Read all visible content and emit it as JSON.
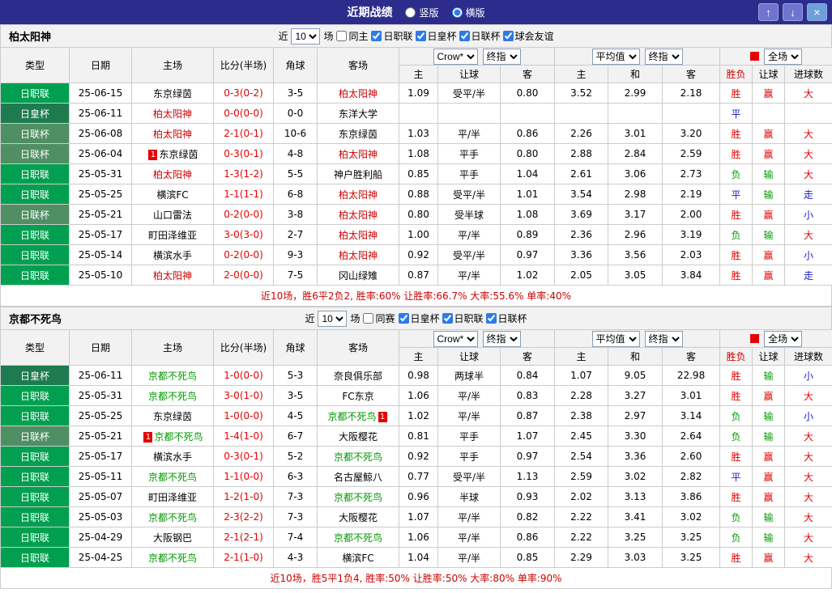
{
  "titlebar": {
    "title": "近期战绩",
    "layout_options": [
      {
        "label": "竖版",
        "selected": false
      },
      {
        "label": "横版",
        "selected": true
      }
    ],
    "buttons": [
      {
        "name": "move-up",
        "glyph": "↑"
      },
      {
        "name": "move-down",
        "glyph": "↓"
      },
      {
        "name": "close",
        "glyph": "×"
      }
    ]
  },
  "columns": {
    "type": "类型",
    "date": "日期",
    "home": "主场",
    "score": "比分(半场)",
    "corner": "角球",
    "away": "客场",
    "bookmaker": "Crow*",
    "stage": "终指",
    "average": "平均值",
    "stage2": "终指",
    "scope": "全场",
    "sub": [
      "主",
      "让球",
      "客",
      "主",
      "和",
      "客",
      "胜负",
      "让球",
      "进球数"
    ]
  },
  "league_colors": {
    "日职联": "#00A050",
    "日皇杯": "#1E7B4F",
    "日联杯": "#4F8F63"
  },
  "result_colors": {
    "胜": "#E60000",
    "平": "#1A1ACD",
    "负": "#009B00",
    "赢": "#E60000",
    "输": "#009B00",
    "走": "#1A1ACD",
    "大": "#E60000",
    "小": "#1A1ACD"
  },
  "sections": [
    {
      "team": "柏太阳神",
      "focus_color": "#D10000",
      "filter": {
        "prefix": "近",
        "count": "10",
        "suffix": "场",
        "same": {
          "label": "同主",
          "checked": false
        },
        "leagues": [
          {
            "label": "日职联",
            "checked": true
          },
          {
            "label": "日皇杯",
            "checked": true
          },
          {
            "label": "日联杯",
            "checked": true
          },
          {
            "label": "球会友谊",
            "checked": true
          }
        ]
      },
      "rows": [
        {
          "league": "日职联",
          "date": "25-06-15",
          "home": "东京绿茵",
          "away": "柏太阳神",
          "away_focus": true,
          "score": "0-3(0-2)",
          "corner": "3-5",
          "odds": [
            "1.09",
            "受平/半",
            "0.80",
            "3.52",
            "2.99",
            "2.18"
          ],
          "result": "胜",
          "handicap": "赢",
          "goals": "大"
        },
        {
          "league": "日皇杯",
          "date": "25-06-11",
          "home": "柏太阳神",
          "home_focus": true,
          "away": "东洋大学",
          "score": "0-0(0-0)",
          "corner": "0-0",
          "odds": [
            "",
            "",
            "",
            "",
            "",
            ""
          ],
          "result": "平",
          "handicap": "",
          "goals": ""
        },
        {
          "league": "日联杯",
          "date": "25-06-08",
          "home": "柏太阳神",
          "home_focus": true,
          "away": "东京绿茵",
          "score": "2-1(0-1)",
          "corner": "10-6",
          "odds": [
            "1.03",
            "平/半",
            "0.86",
            "2.26",
            "3.01",
            "3.20"
          ],
          "result": "胜",
          "handicap": "赢",
          "goals": "大"
        },
        {
          "league": "日联杯",
          "date": "25-06-04",
          "home": "东京绿茵",
          "home_badge_pre": "1",
          "away": "柏太阳神",
          "away_focus": true,
          "score": "0-3(0-1)",
          "corner": "4-8",
          "odds": [
            "1.08",
            "平手",
            "0.80",
            "2.88",
            "2.84",
            "2.59"
          ],
          "result": "胜",
          "handicap": "赢",
          "goals": "大"
        },
        {
          "league": "日职联",
          "date": "25-05-31",
          "home": "柏太阳神",
          "home_focus": true,
          "away": "神户胜利船",
          "score": "1-3(1-2)",
          "corner": "5-5",
          "odds": [
            "0.85",
            "平手",
            "1.04",
            "2.61",
            "3.06",
            "2.73"
          ],
          "result": "负",
          "handicap": "输",
          "goals": "大"
        },
        {
          "league": "日职联",
          "date": "25-05-25",
          "home": "横滨FC",
          "away": "柏太阳神",
          "away_focus": true,
          "score": "1-1(1-1)",
          "corner": "6-8",
          "odds": [
            "0.88",
            "受平/半",
            "1.01",
            "3.54",
            "2.98",
            "2.19"
          ],
          "result": "平",
          "handicap": "输",
          "goals": "走"
        },
        {
          "league": "日联杯",
          "date": "25-05-21",
          "home": "山口雷法",
          "away": "柏太阳神",
          "away_focus": true,
          "score": "0-2(0-0)",
          "corner": "3-8",
          "odds": [
            "0.80",
            "受半球",
            "1.08",
            "3.69",
            "3.17",
            "2.00"
          ],
          "result": "胜",
          "handicap": "赢",
          "goals": "小"
        },
        {
          "league": "日职联",
          "date": "25-05-17",
          "home": "町田泽维亚",
          "away": "柏太阳神",
          "away_focus": true,
          "score": "3-0(3-0)",
          "corner": "2-7",
          "odds": [
            "1.00",
            "平/半",
            "0.89",
            "2.36",
            "2.96",
            "3.19"
          ],
          "result": "负",
          "handicap": "输",
          "goals": "大"
        },
        {
          "league": "日职联",
          "date": "25-05-14",
          "home": "横滨水手",
          "away": "柏太阳神",
          "away_focus": true,
          "score": "0-2(0-0)",
          "corner": "9-3",
          "odds": [
            "0.92",
            "受平/半",
            "0.97",
            "3.36",
            "3.56",
            "2.03"
          ],
          "result": "胜",
          "handicap": "赢",
          "goals": "小"
        },
        {
          "league": "日职联",
          "date": "25-05-10",
          "home": "柏太阳神",
          "home_focus": true,
          "away": "冈山绿雉",
          "score": "2-0(0-0)",
          "corner": "7-5",
          "odds": [
            "0.87",
            "平/半",
            "1.02",
            "2.05",
            "3.05",
            "3.84"
          ],
          "result": "胜",
          "handicap": "赢",
          "goals": "走"
        }
      ],
      "summary": "近10场，胜6平2负2, 胜率:60% 让胜率:66.7% 大率:55.6% 单率:40%"
    },
    {
      "team": "京都不死鸟",
      "focus_color": "#009900",
      "filter": {
        "prefix": "近",
        "count": "10",
        "suffix": "场",
        "same": {
          "label": "同赛",
          "checked": false
        },
        "leagues": [
          {
            "label": "日皇杯",
            "checked": true
          },
          {
            "label": "日职联",
            "checked": true
          },
          {
            "label": "日联杯",
            "checked": true
          }
        ]
      },
      "rows": [
        {
          "league": "日皇杯",
          "date": "25-06-11",
          "home": "京都不死鸟",
          "home_focus": true,
          "away": "奈良俱乐部",
          "score": "1-0(0-0)",
          "corner": "5-3",
          "odds": [
            "0.98",
            "两球半",
            "0.84",
            "1.07",
            "9.05",
            "22.98"
          ],
          "result": "胜",
          "handicap": "输",
          "goals": "小"
        },
        {
          "league": "日职联",
          "date": "25-05-31",
          "home": "京都不死鸟",
          "home_focus": true,
          "away": "FC东京",
          "score": "3-0(1-0)",
          "corner": "3-5",
          "odds": [
            "1.06",
            "平/半",
            "0.83",
            "2.28",
            "3.27",
            "3.01"
          ],
          "result": "胜",
          "handicap": "赢",
          "goals": "大"
        },
        {
          "league": "日职联",
          "date": "25-05-25",
          "home": "东京绿茵",
          "away": "京都不死鸟",
          "away_focus": true,
          "away_badge_post": "1",
          "score": "1-0(0-0)",
          "corner": "4-5",
          "odds": [
            "1.02",
            "平/半",
            "0.87",
            "2.38",
            "2.97",
            "3.14"
          ],
          "result": "负",
          "handicap": "输",
          "goals": "小"
        },
        {
          "league": "日联杯",
          "date": "25-05-21",
          "home": "京都不死鸟",
          "home_focus": true,
          "home_badge_pre": "1",
          "away": "大阪樱花",
          "score": "1-4(1-0)",
          "corner": "6-7",
          "odds": [
            "0.81",
            "平手",
            "1.07",
            "2.45",
            "3.30",
            "2.64"
          ],
          "result": "负",
          "handicap": "输",
          "goals": "大"
        },
        {
          "league": "日职联",
          "date": "25-05-17",
          "home": "横滨水手",
          "away": "京都不死鸟",
          "away_focus": true,
          "score": "0-3(0-1)",
          "corner": "5-2",
          "odds": [
            "0.92",
            "平手",
            "0.97",
            "2.54",
            "3.36",
            "2.60"
          ],
          "result": "胜",
          "handicap": "赢",
          "goals": "大"
        },
        {
          "league": "日职联",
          "date": "25-05-11",
          "home": "京都不死鸟",
          "home_focus": true,
          "away": "名古屋鲸八",
          "score": "1-1(0-0)",
          "corner": "6-3",
          "odds": [
            "0.77",
            "受平/半",
            "1.13",
            "2.59",
            "3.02",
            "2.82"
          ],
          "result": "平",
          "handicap": "赢",
          "goals": "大"
        },
        {
          "league": "日职联",
          "date": "25-05-07",
          "home": "町田泽维亚",
          "away": "京都不死鸟",
          "away_focus": true,
          "score": "1-2(1-0)",
          "corner": "7-3",
          "odds": [
            "0.96",
            "半球",
            "0.93",
            "2.02",
            "3.13",
            "3.86"
          ],
          "result": "胜",
          "handicap": "赢",
          "goals": "大"
        },
        {
          "league": "日职联",
          "date": "25-05-03",
          "home": "京都不死鸟",
          "home_focus": true,
          "away": "大阪樱花",
          "score": "2-3(2-2)",
          "corner": "7-3",
          "odds": [
            "1.07",
            "平/半",
            "0.82",
            "2.22",
            "3.41",
            "3.02"
          ],
          "result": "负",
          "handicap": "输",
          "goals": "大"
        },
        {
          "league": "日职联",
          "date": "25-04-29",
          "home": "大阪钢巴",
          "away": "京都不死鸟",
          "away_focus": true,
          "score": "2-1(2-1)",
          "corner": "7-4",
          "odds": [
            "1.06",
            "平/半",
            "0.86",
            "2.22",
            "3.25",
            "3.25"
          ],
          "result": "负",
          "handicap": "输",
          "goals": "大"
        },
        {
          "league": "日职联",
          "date": "25-04-25",
          "home": "京都不死鸟",
          "home_focus": true,
          "away": "横滨FC",
          "score": "2-1(1-0)",
          "corner": "4-3",
          "odds": [
            "1.04",
            "平/半",
            "0.85",
            "2.29",
            "3.03",
            "3.25"
          ],
          "result": "胜",
          "handicap": "赢",
          "goals": "大"
        }
      ],
      "summary": "近10场，胜5平1负4, 胜率:50% 让胜率:50% 大率:80% 单率:90%"
    }
  ]
}
